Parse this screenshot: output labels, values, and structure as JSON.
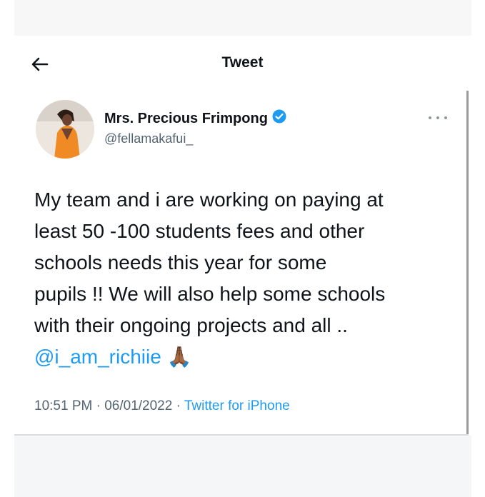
{
  "header": {
    "title": "Tweet"
  },
  "author": {
    "name": "Mrs. Precious Frimpong",
    "handle": "@fellamakafui_",
    "verified": true
  },
  "tweet": {
    "lines": [
      "My team and i are working on paying at",
      "least 50 -100 students fees and other",
      "schools needs this year for some",
      "pupils !! We will also help some schools",
      "with their ongoing projects and all .."
    ],
    "mention": "@i_am_richiie",
    "emoji": "🙏🏾"
  },
  "meta": {
    "time": "10:51 PM",
    "sep1": " · ",
    "date": "06/01/2022",
    "sep2": " · ",
    "source": "Twitter for iPhone"
  },
  "colors": {
    "link": "#1d9bf0",
    "verified_badge": "#1d9bf0",
    "secondary_text": "#536471"
  }
}
